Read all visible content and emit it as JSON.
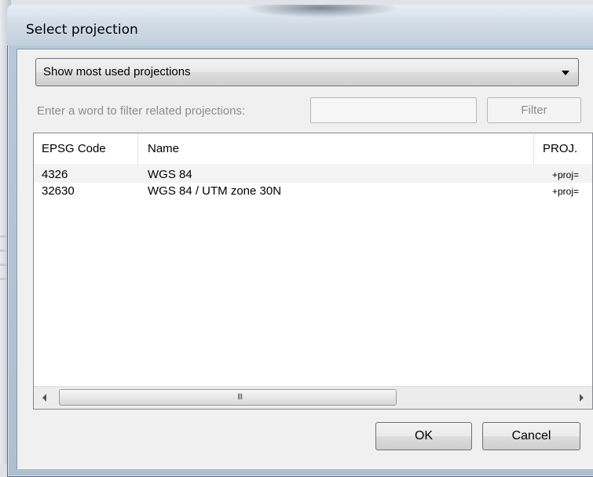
{
  "window": {
    "title": "Select projection"
  },
  "dropdown": {
    "selected": "Show most used projections"
  },
  "filter": {
    "label": "Enter a word to filter related projections:",
    "input_value": "",
    "button_label": "Filter"
  },
  "table": {
    "columns": [
      "EPSG Code",
      "Name",
      "PROJ."
    ],
    "rows": [
      {
        "code": "4326",
        "name": "WGS 84",
        "proj": "+proj="
      },
      {
        "code": "32630",
        "name": "WGS 84 / UTM zone 30N",
        "proj": "+proj="
      }
    ]
  },
  "scrollbar": {
    "grip": "III"
  },
  "buttons": {
    "ok": "OK",
    "cancel": "Cancel"
  },
  "icons": {
    "dropdown_arrow": "triangle-down",
    "scroll_left": "triangle-left",
    "scroll_right": "triangle-right"
  }
}
